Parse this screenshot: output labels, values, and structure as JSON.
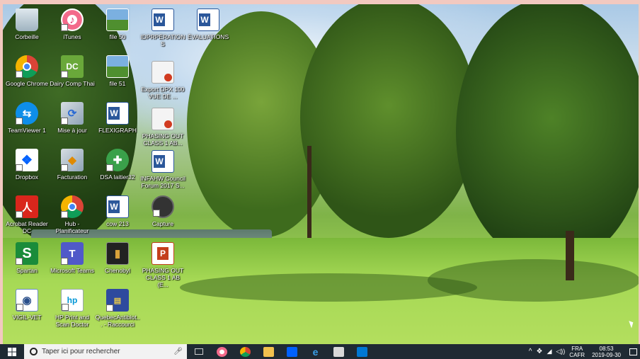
{
  "desktop": {
    "icons": [
      {
        "label": "Corbeille"
      },
      {
        "label": "iTunes"
      },
      {
        "label": "file 50"
      },
      {
        "label": "IDPRPÉRATIONS"
      },
      {
        "label": "ÉVALUATIONS"
      },
      {
        "label": "Google Chrome"
      },
      {
        "label": "Dairy Comp Thai"
      },
      {
        "label": "file 51"
      },
      {
        "label": "Export DPX 100 VUE DE ..."
      },
      {
        "label": "TeamViewer 1"
      },
      {
        "label": "Mise à jour"
      },
      {
        "label": "FLEXIGRAPH"
      },
      {
        "label": "PHASING OUT CLASS 1 AB..."
      },
      {
        "label": "Dropbox"
      },
      {
        "label": "Facturation"
      },
      {
        "label": "DSA laitier32"
      },
      {
        "label": "INFAHW Council Forum 2017 S..."
      },
      {
        "label": "Acrobat Reader DC"
      },
      {
        "label": "Hub - Planificateur"
      },
      {
        "label": "cow 213"
      },
      {
        "label": "Capture"
      },
      {
        "label": "Spartan"
      },
      {
        "label": "Microsoft Teams"
      },
      {
        "label": "Chenobyl"
      },
      {
        "label": "PHASING OUT CLASS 1 AB (E..."
      },
      {
        "label": "VIGIL-VET"
      },
      {
        "label": "HP Print and Scan Doctor"
      },
      {
        "label": "QuebecAntibiot... - Raccourci"
      }
    ]
  },
  "taskbar": {
    "search_placeholder": "Taper ici pour rechercher",
    "apps": [
      "task-view",
      "itunes",
      "chrome",
      "file-explorer",
      "dropbox",
      "edge",
      "notes",
      "outlook"
    ],
    "tray": {
      "language_top": "FRA",
      "language_bottom": "CAFR",
      "time": "08:53",
      "date": "2019-09-30"
    }
  }
}
